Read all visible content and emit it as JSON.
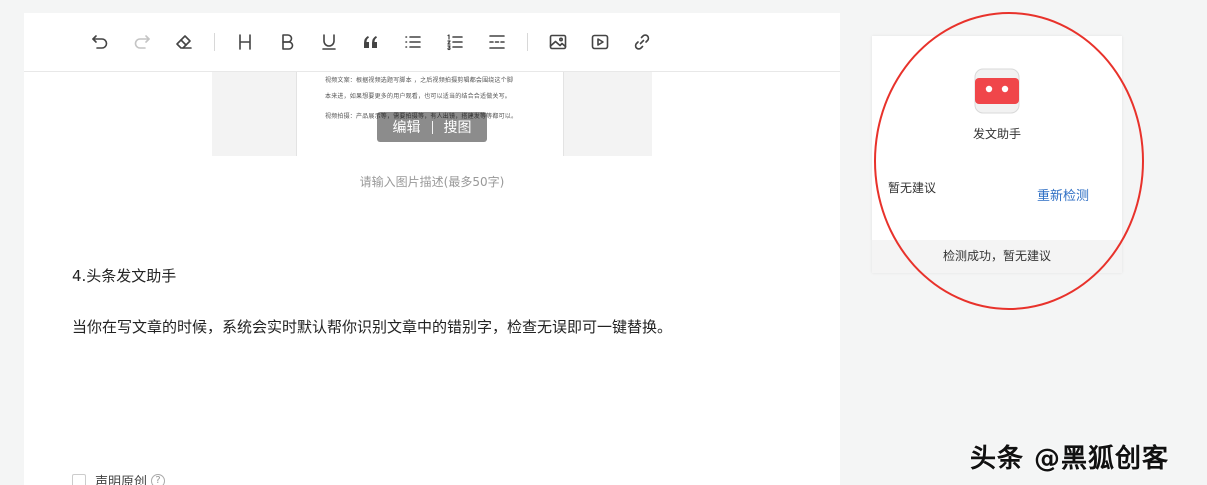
{
  "toolbar": {
    "tools": [
      "undo-icon",
      "redo-icon",
      "eraser-icon",
      "heading-icon",
      "bold-icon",
      "underline-icon",
      "quote-icon",
      "bullet-list-icon",
      "numbered-list-icon",
      "divider-icon",
      "image-icon",
      "video-icon",
      "link-icon"
    ]
  },
  "image": {
    "lines": [
      "视频文案：根据视频选题写脚本 ，之后视频拍摄剪辑都会围绕这个脚",
      "本来进，如果想要更多的用户观看，也可以适当的结合合适做关写。",
      "视频拍摄：产品展示等，需要拍摄等，有人出镜，搭建发等等都可以。"
    ],
    "edit_label": "编辑",
    "search_label": "搜图",
    "caption_placeholder": "请输入图片描述(最多50字)"
  },
  "content": {
    "heading": "4.头条发文助手",
    "paragraph": "当你在写文章的时候，系统会实时默认帮你识别文章中的错别字，检查无误即可一键替换。"
  },
  "footer": {
    "original_label": "声明原创",
    "help_mark": "?"
  },
  "assistant": {
    "title": "发文助手",
    "no_suggestion": "暂无建议",
    "recheck_label": "重新检测",
    "status": "检测成功，暂无建议",
    "accent": "#f0464a",
    "link_color": "#2d6ec4"
  },
  "annotation": {
    "circle_color": "#e8322b"
  },
  "watermark": "头条 @黑狐创客"
}
